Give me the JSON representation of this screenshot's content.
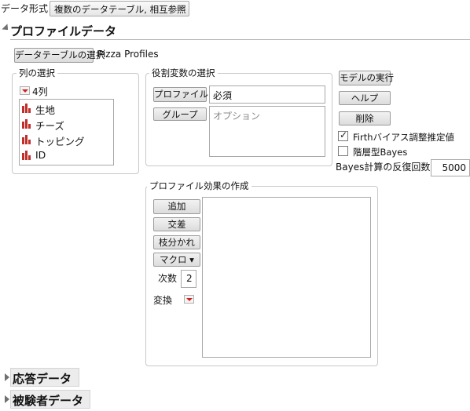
{
  "data_format": {
    "label": "データ形式",
    "selected": "複数のデータテーブル, 相互参照"
  },
  "profile_section": {
    "title": "プロファイルデータ",
    "select_table_button": "データテーブルの選択",
    "table_name": "Pizza Profiles"
  },
  "column_select": {
    "legend": "列の選択",
    "count": "4列",
    "items": [
      {
        "label": "生地",
        "icon": "bar-chart-icon"
      },
      {
        "label": "チーズ",
        "icon": "bar-chart-icon"
      },
      {
        "label": "トッピング",
        "icon": "bar-chart-icon"
      },
      {
        "label": "ID",
        "icon": "bar-chart-icon"
      }
    ]
  },
  "role_select": {
    "legend": "役割変数の選択",
    "profile_id_button": "プロファイルID",
    "profile_id_value": "必須",
    "group_button": "グループ",
    "group_placeholder": "オプション"
  },
  "actions": {
    "run_model": "モデルの実行",
    "help": "ヘルプ",
    "delete": "削除",
    "firth_label": "Firthバイアス調整推定値",
    "firth_checked": true,
    "hier_bayes_label": "階層型Bayes",
    "hier_bayes_checked": false,
    "bayes_iter_label": "Bayes計算の反復回数",
    "bayes_iter_value": "5000"
  },
  "effects": {
    "legend": "プロファイル効果の作成",
    "add": "追加",
    "cross": "交差",
    "nest": "枝分かれ",
    "macro": "マクロ ▾",
    "degree_label": "次数",
    "degree_value": "2",
    "transform_label": "変換"
  },
  "collapsed_sections": {
    "response": "応答データ",
    "subject": "被験者データ"
  },
  "colors": {
    "icon_red": "#c0302a",
    "menu_red": "#d02020"
  }
}
